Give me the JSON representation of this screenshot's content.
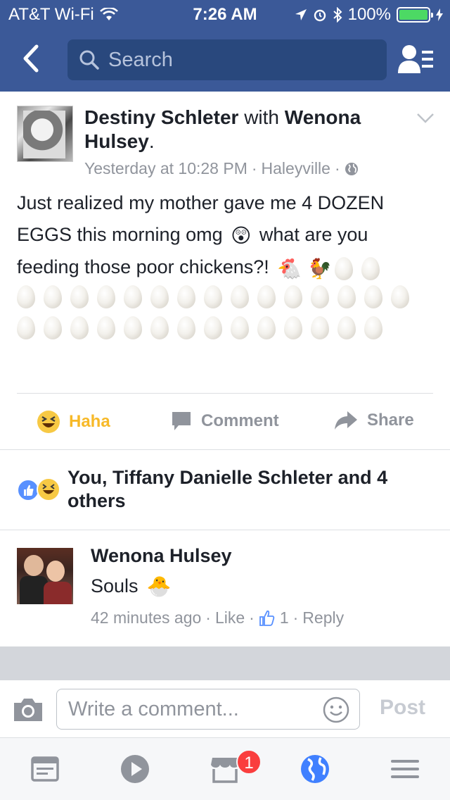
{
  "status_bar": {
    "carrier": "AT&T Wi-Fi",
    "time": "7:26 AM",
    "battery": "100%"
  },
  "nav": {
    "search_placeholder": "Search"
  },
  "post": {
    "author": "Destiny Schleter",
    "with_word": "with",
    "tagged": "Wenona Hulsey",
    "time": "Yesterday at 10:28 PM",
    "location": "Haleyville",
    "text_line1": "Just realized my mother gave me 4 DOZEN",
    "text_line2_a": "EGGS this morning omg",
    "text_line2_b": "what are you",
    "text_line3": "feeding those poor chickens?!",
    "emoji_shocked": "😲",
    "emoji_chicken": "🐔",
    "emoji_rooster": "🐓",
    "eggs_inline_count": 2,
    "eggs_block_count": 29
  },
  "actions": {
    "haha": "Haha",
    "comment": "Comment",
    "share": "Share"
  },
  "reactions": {
    "summary": "You, Tiffany Danielle Schleter and 4 others"
  },
  "comment": {
    "author": "Wenona Hulsey",
    "text": "Souls",
    "emoji": "🐣",
    "time": "42 minutes ago",
    "like": "Like",
    "like_count": "1",
    "reply": "Reply"
  },
  "composer": {
    "placeholder": "Write a comment...",
    "post": "Post"
  },
  "tabbar": {
    "badge": "1"
  },
  "colors": {
    "brand": "#3b5998",
    "haha": "#f7b928",
    "meta": "#90949c",
    "badge": "#fa3e3e"
  }
}
